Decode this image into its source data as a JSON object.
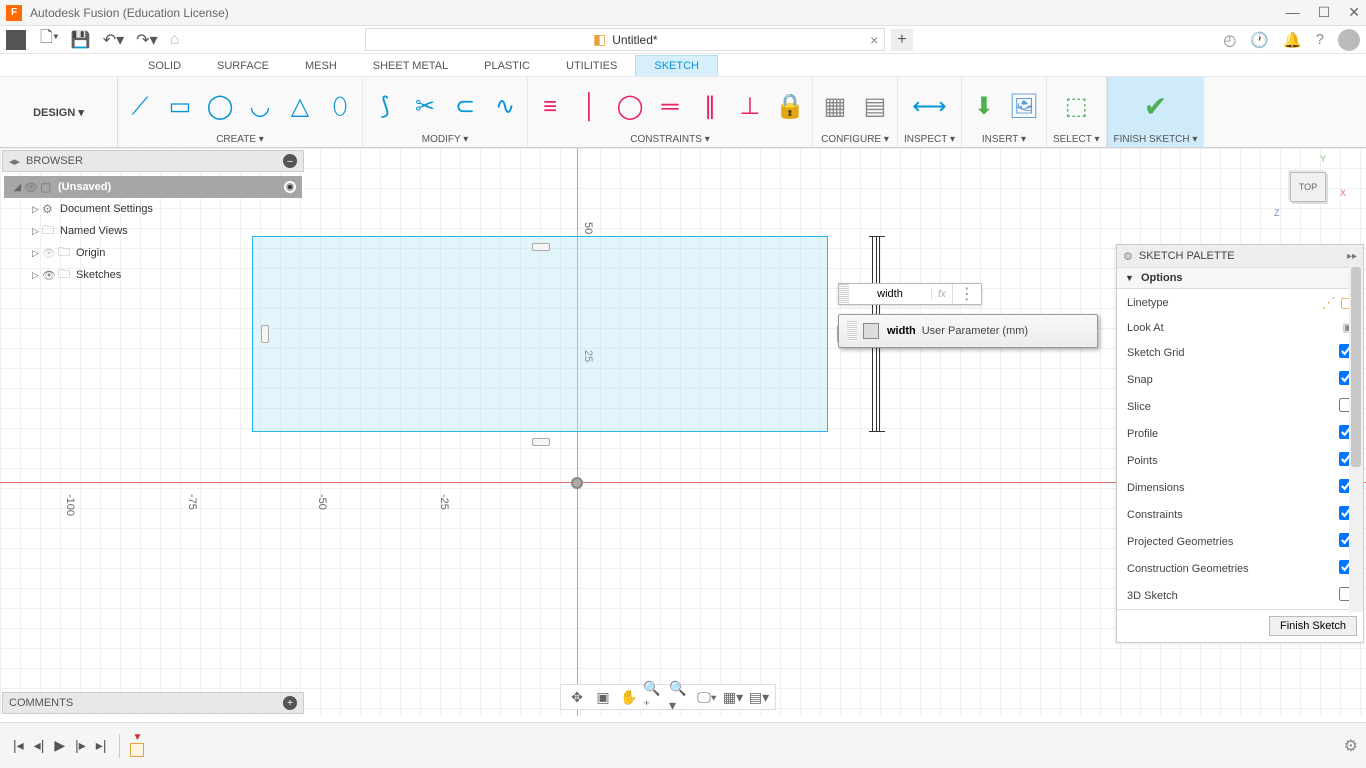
{
  "app": {
    "title": "Autodesk Fusion (Education License)"
  },
  "document": {
    "name": "Untitled*"
  },
  "ribbonTabs": [
    "SOLID",
    "SURFACE",
    "MESH",
    "SHEET METAL",
    "PLASTIC",
    "UTILITIES",
    "SKETCH"
  ],
  "activeTab": "SKETCH",
  "designButton": "DESIGN ▾",
  "ribbonGroups": {
    "create": "CREATE ▾",
    "modify": "MODIFY ▾",
    "constraints": "CONSTRAINTS ▾",
    "configure": "CONFIGURE ▾",
    "inspect": "INSPECT ▾",
    "insert": "INSERT ▾",
    "select": "SELECT ▾",
    "finish": "FINISH SKETCH ▾"
  },
  "browser": {
    "title": "BROWSER",
    "root": "(Unsaved)",
    "items": [
      "Document Settings",
      "Named Views",
      "Origin",
      "Sketches"
    ]
  },
  "axisLabels": {
    "n100": "-100",
    "n75": "-75",
    "n50": "-50",
    "n25": "-25",
    "p25": "25",
    "p50": "50"
  },
  "dimension": {
    "value": "width",
    "suggestName": "width",
    "suggestDesc": "User Parameter (mm)",
    "fx": "fx"
  },
  "viewcube": {
    "face": "TOP",
    "x": "X",
    "y": "Y",
    "z": "Z"
  },
  "palette": {
    "title": "SKETCH PALETTE",
    "section": "Options",
    "rows": [
      {
        "label": "Linetype",
        "type": "icons"
      },
      {
        "label": "Look At",
        "type": "icon"
      },
      {
        "label": "Sketch Grid",
        "type": "check",
        "checked": true
      },
      {
        "label": "Snap",
        "type": "check",
        "checked": true
      },
      {
        "label": "Slice",
        "type": "check",
        "checked": false
      },
      {
        "label": "Profile",
        "type": "check",
        "checked": true
      },
      {
        "label": "Points",
        "type": "check",
        "checked": true
      },
      {
        "label": "Dimensions",
        "type": "check",
        "checked": true
      },
      {
        "label": "Constraints",
        "type": "check",
        "checked": true
      },
      {
        "label": "Projected Geometries",
        "type": "check",
        "checked": true
      },
      {
        "label": "Construction Geometries",
        "type": "check",
        "checked": true
      },
      {
        "label": "3D Sketch",
        "type": "check",
        "checked": false
      }
    ],
    "finish": "Finish Sketch"
  },
  "comments": "COMMENTS"
}
